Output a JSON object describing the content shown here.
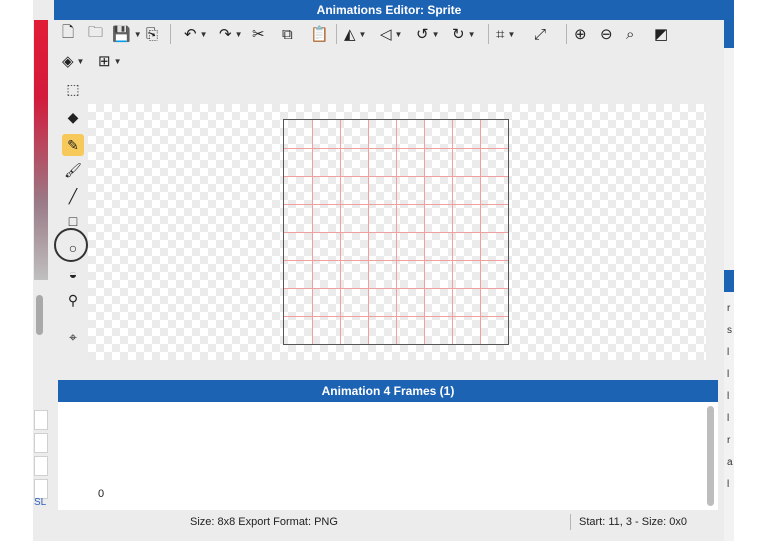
{
  "window": {
    "title": "Animations Editor: Sprite"
  },
  "toolbar": {
    "row1": [
      {
        "name": "new-file-icon",
        "glyph": "🗋",
        "dropdown": false
      },
      {
        "name": "open-folder-icon",
        "glyph": "🗀",
        "dropdown": false
      },
      {
        "name": "save-icon",
        "glyph": "💾",
        "dropdown": true
      },
      {
        "name": "export-icon",
        "glyph": "⎘",
        "dropdown": false
      },
      {
        "name": "undo-icon",
        "glyph": "↶",
        "dropdown": true
      },
      {
        "name": "redo-icon",
        "glyph": "↷",
        "dropdown": true
      },
      {
        "name": "cut-icon",
        "glyph": "✂",
        "dropdown": false
      },
      {
        "name": "copy-icon",
        "glyph": "⧉",
        "dropdown": false
      },
      {
        "name": "paste-icon",
        "glyph": "📋",
        "dropdown": false
      },
      {
        "name": "flip-horizontal-icon",
        "glyph": "◭",
        "dropdown": true
      },
      {
        "name": "flip-vertical-icon",
        "glyph": "◁",
        "dropdown": true
      },
      {
        "name": "rotate-left-icon",
        "glyph": "↺",
        "dropdown": true
      },
      {
        "name": "rotate-right-icon",
        "glyph": "↻",
        "dropdown": true
      },
      {
        "name": "crop-icon",
        "glyph": "⌗",
        "dropdown": true
      },
      {
        "name": "resize-icon",
        "glyph": "⤢",
        "dropdown": false
      },
      {
        "name": "zoom-in-icon",
        "glyph": "⊕",
        "dropdown": false
      },
      {
        "name": "zoom-out-icon",
        "glyph": "⊖",
        "dropdown": false
      },
      {
        "name": "zoom-fit-icon",
        "glyph": "⌕",
        "dropdown": false
      },
      {
        "name": "background-toggle-icon",
        "glyph": "◩",
        "dropdown": false
      }
    ],
    "row2": [
      {
        "name": "layers-icon",
        "glyph": "◈",
        "dropdown": true
      },
      {
        "name": "grid-icon",
        "glyph": "⊞",
        "dropdown": true
      }
    ]
  },
  "tools": [
    {
      "name": "marquee-select-tool",
      "glyph": "⬚"
    },
    {
      "name": "eraser-tool",
      "glyph": "◆"
    },
    {
      "name": "pencil-tool",
      "glyph": "✎",
      "active": true
    },
    {
      "name": "brush-tool",
      "glyph": "🖌"
    },
    {
      "name": "line-tool",
      "glyph": "╱"
    },
    {
      "name": "rectangle-tool",
      "glyph": "□"
    },
    {
      "name": "ellipse-tool",
      "glyph": "○"
    },
    {
      "name": "fill-bucket-tool",
      "glyph": "◒"
    },
    {
      "name": "eyedropper-tool",
      "glyph": "⚲"
    },
    {
      "name": "origin-point-tool",
      "glyph": "⌖"
    }
  ],
  "canvas": {
    "sprite_width": 8,
    "sprite_height": 8
  },
  "animation_panel": {
    "title": "Animation 4 Frames (1)",
    "frame_label": "0"
  },
  "status": {
    "left": "Size: 8x8   Export Format: PNG",
    "right": "Start: 11, 3 - Size: 0x0"
  },
  "background_app": {
    "link_text": "SL",
    "right_letters": [
      "r",
      "s",
      "l",
      "l",
      "l",
      "l",
      "r",
      "a",
      "l"
    ]
  },
  "colors": {
    "accent": "#1d63b3",
    "active_tool": "#f7c85a",
    "grid_line": "#f0a0a0"
  }
}
